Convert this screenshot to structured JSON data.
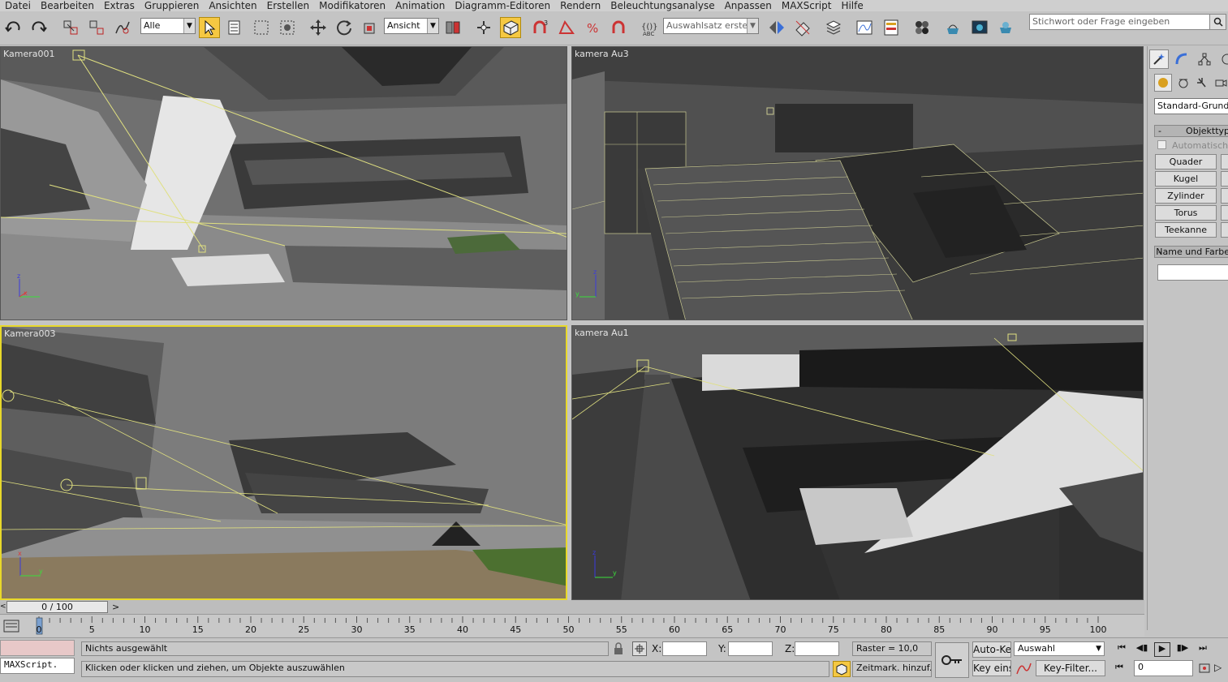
{
  "menu": [
    "Datei",
    "Bearbeiten",
    "Extras",
    "Gruppieren",
    "Ansichten",
    "Erstellen",
    "Modifikatoren",
    "Animation",
    "Diagramm-Editoren",
    "Rendern",
    "Beleuchtungsanalyse",
    "Anpassen",
    "MAXScript",
    "Hilfe"
  ],
  "toolbar": {
    "filter_value": "Alle",
    "refcoord_value": "Ansicht",
    "selection_set_placeholder": "Auswahlsatz erstellen",
    "search_placeholder": "Stichwort oder Frage eingeben"
  },
  "viewports": {
    "top_left": {
      "label": "Kamera001"
    },
    "top_right": {
      "label": "kamera Au3"
    },
    "bottom_left": {
      "label": "Kamera003"
    },
    "bottom_right": {
      "label": "kamera Au1"
    }
  },
  "command_panel": {
    "category": "Standard-Grundkörper",
    "object_type_title": "Objekttyp",
    "autogrid": "Automatisches Raster",
    "buttons": [
      "Quader",
      "Kugel",
      "Zylinder",
      "Torus",
      "Teekanne"
    ],
    "name_color_title": "Name und Farbe"
  },
  "timeline": {
    "frame_counter": "0 / 100",
    "ticks": [
      "0",
      "5",
      "10",
      "15",
      "20",
      "25",
      "30",
      "35",
      "40",
      "45",
      "50",
      "55",
      "60",
      "65",
      "70",
      "75",
      "80",
      "85",
      "90",
      "95",
      "100"
    ]
  },
  "status": {
    "maxscript": "MAXScript.",
    "selection_info": "Nichts ausgewählt",
    "prompt": "Klicken oder klicken und ziehen, um Objekte auszuwählen",
    "x_label": "X:",
    "y_label": "Y:",
    "z_label": "Z:",
    "grid": "Raster = 10,0",
    "add_time_tag": "Zeitmark. hinzuf.",
    "auto_key": "Auto-Key",
    "set_key": "Key einst.",
    "key_mode": "Auswahl",
    "key_filters": "Key-Filter...",
    "current_frame": "0"
  }
}
